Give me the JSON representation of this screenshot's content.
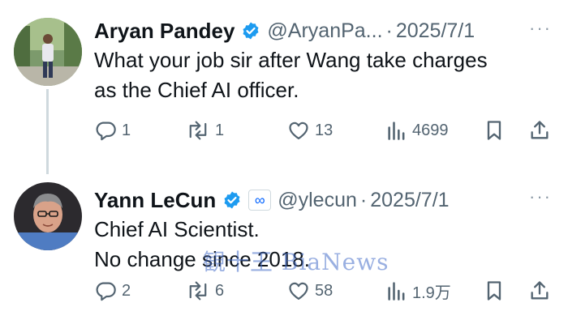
{
  "tweets": [
    {
      "author_name": "Aryan Pandey",
      "handle": "@AryanPa...",
      "separator": "·",
      "date": "2025/7/1",
      "more": "···",
      "body_lines": [
        "What your job sir after Wang take charges",
        "as the Chief AI officer."
      ],
      "reply_count": "1",
      "retweet_count": "1",
      "like_count": "13",
      "view_count": "4699",
      "icons": [
        "reply-icon",
        "retweet-icon",
        "like-icon",
        "views-icon",
        "bookmark-icon",
        "share-icon"
      ]
    },
    {
      "author_name": "Yann LeCun",
      "affiliation_badge": "∞",
      "handle": "@ylecun",
      "separator": "·",
      "date": "2025/7/1",
      "more": "···",
      "body_lines": [
        "Chief AI Scientist.",
        "No change since 2018."
      ],
      "reply_count": "2",
      "retweet_count": "6",
      "like_count": "58",
      "view_count": "1.9万",
      "icons": [
        "reply-icon",
        "retweet-icon",
        "like-icon",
        "views-icon",
        "bookmark-icon",
        "share-icon"
      ]
    }
  ],
  "watermark": "観十王 BiaNews",
  "colors": {
    "text": "#0f1419",
    "muted": "#536471",
    "verified": "#1d9bf0",
    "thread_line": "#cfd9de"
  }
}
